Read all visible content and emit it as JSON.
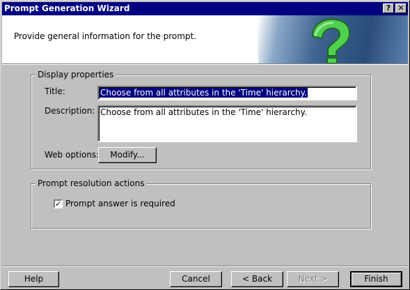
{
  "window": {
    "title": "Prompt Generation Wizard",
    "help_glyph": "?",
    "close_glyph": "✕"
  },
  "header": {
    "description": "Provide general information for the prompt."
  },
  "display_properties": {
    "legend": "Display properties",
    "title_label": "Title:",
    "title_value": "Choose from all attributes in the 'Time' hierarchy.",
    "description_label": "Description:",
    "description_value": "Choose from all attributes in the 'Time' hierarchy.",
    "web_options_label": "Web options:",
    "modify_button": "Modify..."
  },
  "resolution": {
    "legend": "Prompt resolution actions",
    "checkbox_label": "Prompt answer is required",
    "checked": true
  },
  "buttons": {
    "help": "Help",
    "cancel": "Cancel",
    "back": "< Back",
    "next": "Next >",
    "finish": "Finish"
  }
}
